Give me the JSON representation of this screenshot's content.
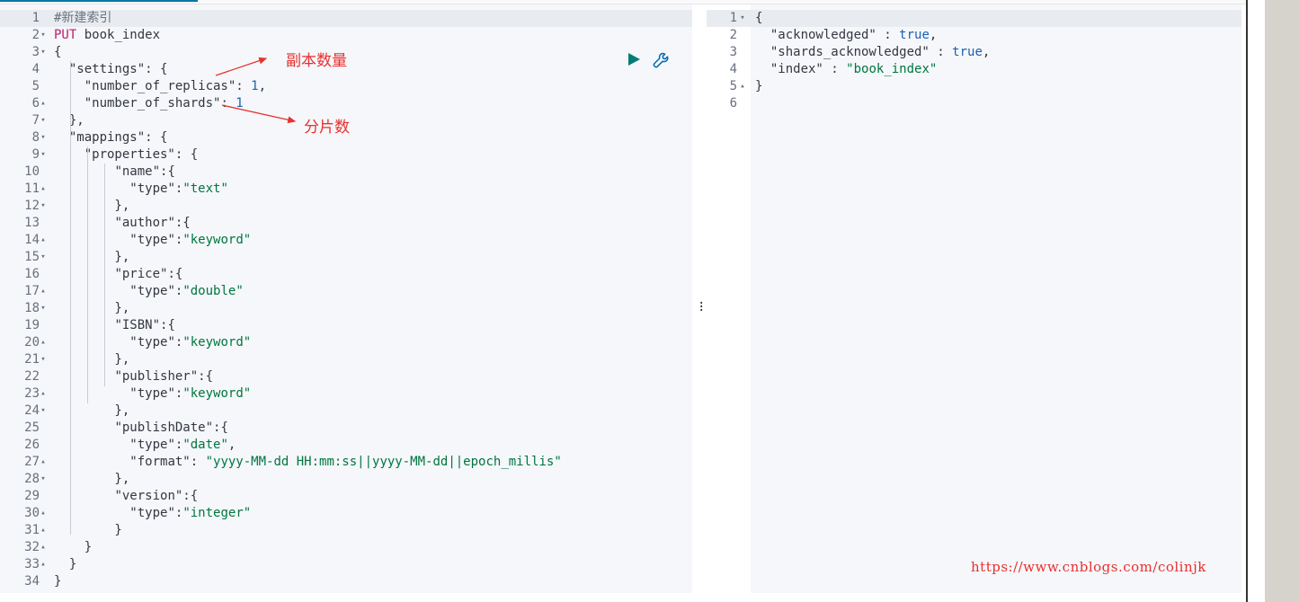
{
  "request_editor": {
    "comment": "#新建索引",
    "method": "PUT",
    "path": "book_index",
    "line_numbers": [
      "1",
      "2",
      "3",
      "4",
      "5",
      "6",
      "7",
      "8",
      "9",
      "10",
      "11",
      "12",
      "13",
      "14",
      "15",
      "16",
      "17",
      "18",
      "19",
      "20",
      "21",
      "22",
      "23",
      "24",
      "25",
      "26",
      "27",
      "28",
      "29",
      "30",
      "31",
      "32",
      "33",
      "34"
    ],
    "lines": [
      "{",
      "  \"settings\": {",
      "    \"number_of_replicas\": 1,",
      "    \"number_of_shards\": 1",
      "  },",
      "  \"mappings\": {",
      "    \"properties\": {",
      "        \"name\":{",
      "          \"type\":\"text\"",
      "        },",
      "        \"author\":{",
      "          \"type\":\"keyword\"",
      "        },",
      "        \"price\":{",
      "          \"type\":\"double\"",
      "        },",
      "        \"ISBN\":{",
      "          \"type\":\"keyword\"",
      "        },",
      "        \"publisher\":{",
      "          \"type\":\"keyword\"",
      "        },",
      "        \"publishDate\":{",
      "          \"type\":\"date\",",
      "          \"format\": \"yyyy-MM-dd HH:mm:ss||yyyy-MM-dd||epoch_millis\"",
      "        },",
      "        \"version\":{",
      "          \"type\":\"integer\"",
      "        }",
      "    }",
      "  }",
      "}"
    ],
    "annotations": {
      "replicas": "副本数量",
      "shards": "分片数"
    },
    "icons": {
      "run": "play-icon",
      "settings": "wrench-icon"
    }
  },
  "response_editor": {
    "line_numbers": [
      "1",
      "2",
      "3",
      "4",
      "5",
      "6"
    ],
    "lines": [
      "{",
      "  \"acknowledged\" : true,",
      "  \"shards_acknowledged\" : true,",
      "  \"index\" : \"book_index\"",
      "}",
      ""
    ]
  },
  "watermark": "https://www.cnblogs.com/colinjk",
  "colors": {
    "string": "#00763e",
    "number": "#1a5fb4",
    "method": "#c01b6a",
    "annotation": "#e8302f"
  }
}
